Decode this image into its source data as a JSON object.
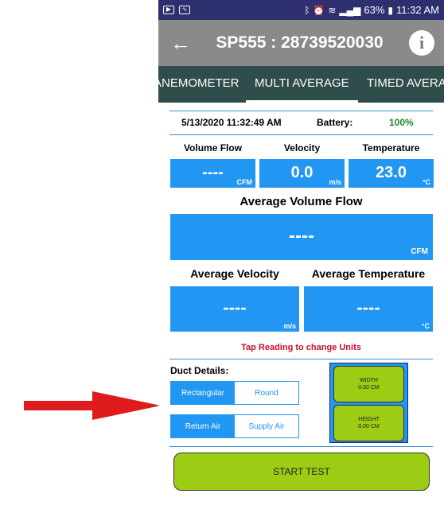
{
  "status_bar": {
    "battery_percent": "63%",
    "time": "11:32 AM",
    "left_icons": [
      "youtube-icon",
      "pulse-icon"
    ],
    "right_icons": [
      "bluetooth-icon",
      "alarm-icon",
      "wifi-icon",
      "signal-icon",
      "battery-icon"
    ]
  },
  "app_bar": {
    "title": "SP555 : 28739520030",
    "back_icon": "arrow-left-icon",
    "info_icon": "info-icon",
    "info_glyph": "i"
  },
  "tabs": [
    {
      "label": "ANEMOMETER",
      "active": false
    },
    {
      "label": "MULTI AVERAGE",
      "active": true
    },
    {
      "label": "TIMED AVERAGE",
      "active": false
    }
  ],
  "info": {
    "datetime": "5/13/2020 11:32:49 AM",
    "battery_label": "Battery:",
    "battery_value": "100%"
  },
  "readings": {
    "volume_flow": {
      "label": "Volume Flow",
      "value": "----",
      "unit": "CFM"
    },
    "velocity": {
      "label": "Velocity",
      "value": "0.0",
      "unit": "m/s"
    },
    "temperature": {
      "label": "Temperature",
      "value": "23.0",
      "unit": "°C"
    }
  },
  "averages": {
    "volume_flow": {
      "label": "Average Volume Flow",
      "value": "----",
      "unit": "CFM"
    },
    "velocity": {
      "label": "Average Velocity",
      "value": "----",
      "unit": "m/s"
    },
    "temperature": {
      "label": "Average Temperature",
      "value": "----",
      "unit": "°C"
    }
  },
  "tap_note": "Tap Reading to change Units",
  "duct": {
    "label": "Duct Details:",
    "shape_options": [
      {
        "label": "Rectangular",
        "selected": true
      },
      {
        "label": "Round",
        "selected": false
      }
    ],
    "air_options": [
      {
        "label": "Return Air",
        "selected": true
      },
      {
        "label": "Supply Air",
        "selected": false
      }
    ],
    "width": {
      "label": "WIDTH",
      "value": "0.00 CM"
    },
    "height": {
      "label": "HEIGHT",
      "value": "0.00 CM"
    }
  },
  "start_button": "START TEST",
  "colors": {
    "status_bar": "#2e2f6f",
    "app_bar": "#8a8a8a",
    "tab_bar": "#2f4d4a",
    "reading_box": "#2196f3",
    "button_green": "#9ccc13",
    "battery_green": "#1c8a2c",
    "note_red": "#c8102e",
    "annotation_arrow": "#e01b1b"
  }
}
